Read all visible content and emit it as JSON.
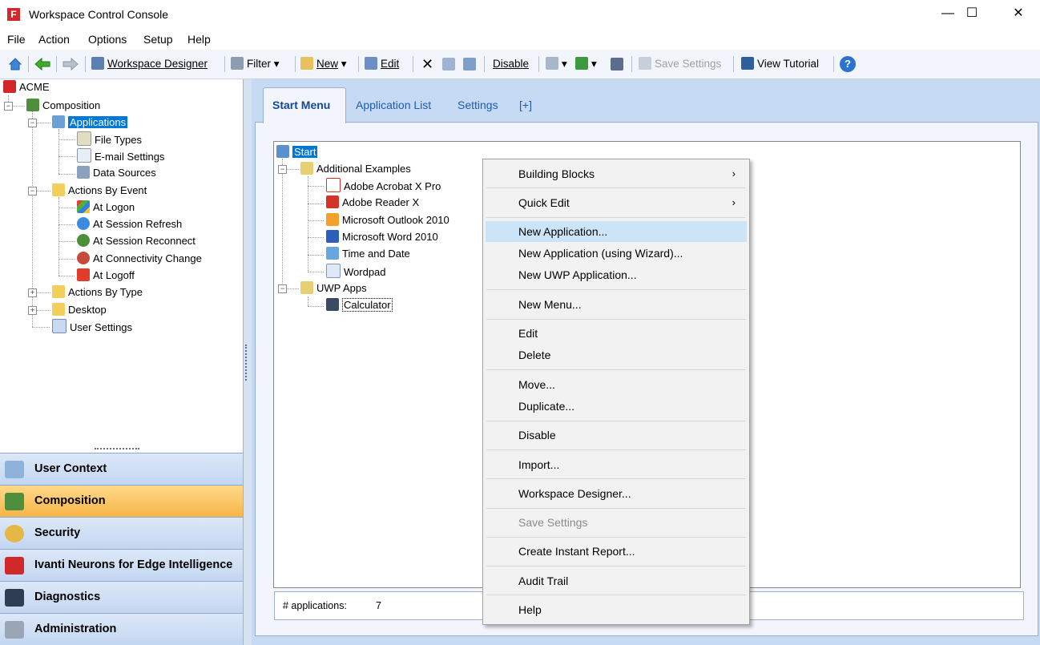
{
  "window": {
    "title": "Workspace Control Console",
    "logo": "F",
    "min": "—",
    "max": "☐",
    "close": "✕"
  },
  "menubar": [
    "File",
    "Action",
    "Options",
    "Setup",
    "Help"
  ],
  "toolbar": {
    "workspace_designer": "Workspace Designer",
    "filter": "Filter",
    "new": "New",
    "edit": "Edit",
    "disable": "Disable",
    "save_settings": "Save Settings",
    "view_tutorial": "View Tutorial",
    "dropdown": "▾",
    "help": "?"
  },
  "left_tree": {
    "root": "ACME",
    "composition": "Composition",
    "applications": "Applications",
    "file_types": "File Types",
    "email_settings": "E-mail Settings",
    "data_sources": "Data Sources",
    "actions_by_event": "Actions By Event",
    "at_logon": "At Logon",
    "at_session_refresh": "At Session Refresh",
    "at_session_reconnect": "At Session Reconnect",
    "at_connectivity_change": "At Connectivity Change",
    "at_logoff": "At Logoff",
    "actions_by_type": "Actions By Type",
    "desktop": "Desktop",
    "user_settings": "User Settings",
    "minus": "−",
    "plus": "+"
  },
  "nav": {
    "user_context": "User Context",
    "composition": "Composition",
    "security": "Security",
    "ivanti": "Ivanti Neurons for Edge Intelligence",
    "diagnostics": "Diagnostics",
    "administration": "Administration"
  },
  "tabs": {
    "start_menu": "Start Menu",
    "application_list": "Application List",
    "settings": "Settings",
    "add": "[+]"
  },
  "start_tree": {
    "start": "Start",
    "additional_examples": "Additional Examples",
    "acrobat": "Adobe Acrobat X Pro",
    "reader": "Adobe Reader X",
    "outlook": "Microsoft Outlook 2010",
    "word": "Microsoft Word 2010",
    "time_date": "Time and Date",
    "wordpad": "Wordpad",
    "uwp_apps": "UWP Apps",
    "calculator": "Calculator"
  },
  "status": {
    "label": "# applications:",
    "count": "7"
  },
  "context_menu": {
    "building_blocks": "Building Blocks",
    "quick_edit": "Quick Edit",
    "new_application": "New Application...",
    "new_application_wizard": "New Application (using Wizard)...",
    "new_uwp_application": "New UWP Application...",
    "new_menu": "New Menu...",
    "edit": "Edit",
    "delete": "Delete",
    "move": "Move...",
    "duplicate": "Duplicate...",
    "disable": "Disable",
    "import": "Import...",
    "workspace_designer": "Workspace Designer...",
    "save_settings": "Save Settings",
    "create_instant_report": "Create Instant Report...",
    "audit_trail": "Audit Trail",
    "help": "Help",
    "arrow": "›"
  },
  "colors": {
    "accent": "#0078d7",
    "nav_active": "#f7b548",
    "brand_red": "#d0282b"
  }
}
